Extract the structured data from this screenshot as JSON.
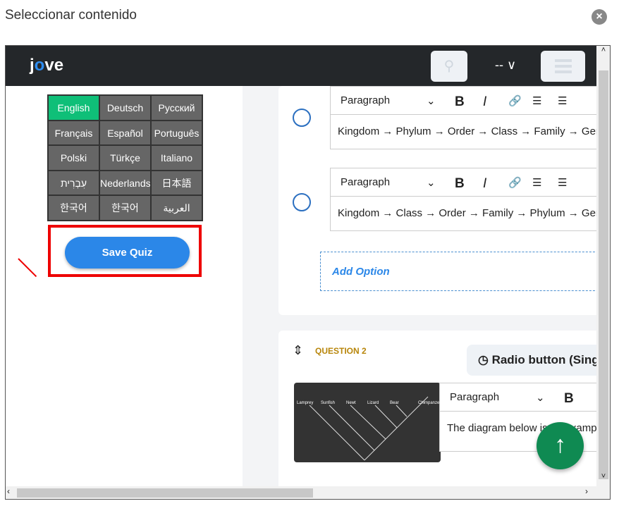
{
  "dialog": {
    "title": "Seleccionar contenido",
    "close_icon": "close-circle-icon"
  },
  "nav": {
    "logo": "jove",
    "lang": "-- ∨",
    "search_icon": "search-icon",
    "menu_icon": "hamburger-icon"
  },
  "languages": [
    "English",
    "Deutsch",
    "Русский",
    "Français",
    "Español",
    "Português",
    "Polski",
    "Türkçe",
    "Italiano",
    "עִבְרִית",
    "Nederlands",
    "日本語",
    "한국어",
    "한국어",
    "العربية"
  ],
  "selected_language": "English",
  "save_label": "Save Quiz",
  "options": [
    {
      "format": "Paragraph",
      "text": "Kingdom → Phylum → Order → Class → Family → Genus"
    },
    {
      "format": "Paragraph",
      "text": "Kingdom → Class → Order → Family → Phylum → Genus"
    }
  ],
  "add_option": "Add Option",
  "question2": {
    "label": "QUESTION 2",
    "type": "Radio button (Single",
    "format": "Paragraph",
    "text": "The diagram below is an example",
    "image_labels": [
      "Lamprey",
      "Sunfish",
      "Newt",
      "Lizard",
      "Bear",
      "Chimpanzee"
    ]
  },
  "colors": {
    "accent": "#2b87e8",
    "selected_lang": "#0fbf78",
    "question_label": "#b8860b",
    "fab": "#0f8a52"
  }
}
